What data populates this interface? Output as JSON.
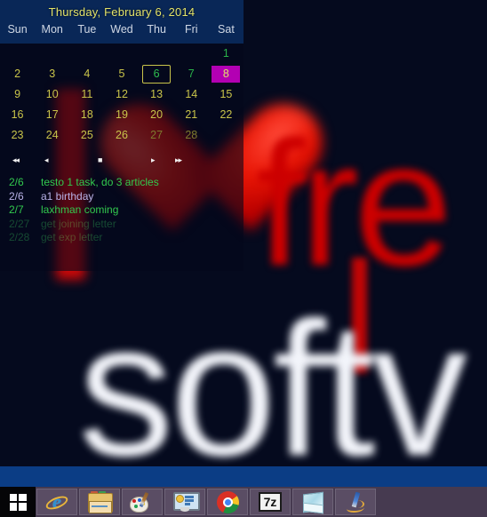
{
  "wallpaper": {
    "watermark_red": "fre",
    "watermark_white": "softv",
    "note": "blurred red heart graphic"
  },
  "calendar": {
    "title": "Thursday, February 6, 2014",
    "day_headers": [
      "Sun",
      "Mon",
      "Tue",
      "Wed",
      "Thu",
      "Fri",
      "Sat"
    ],
    "weeks": [
      [
        {
          "num": "",
          "state": "empty"
        },
        {
          "num": "",
          "state": "empty"
        },
        {
          "num": "",
          "state": "empty"
        },
        {
          "num": "",
          "state": "empty"
        },
        {
          "num": "",
          "state": "empty"
        },
        {
          "num": "",
          "state": "empty"
        },
        {
          "num": "1",
          "state": "green"
        }
      ],
      [
        {
          "num": "2",
          "state": "normal"
        },
        {
          "num": "3",
          "state": "normal"
        },
        {
          "num": "4",
          "state": "normal"
        },
        {
          "num": "5",
          "state": "normal"
        },
        {
          "num": "6",
          "state": "today"
        },
        {
          "num": "7",
          "state": "green"
        },
        {
          "num": "8",
          "state": "selected"
        }
      ],
      [
        {
          "num": "9",
          "state": "normal"
        },
        {
          "num": "10",
          "state": "normal"
        },
        {
          "num": "11",
          "state": "normal"
        },
        {
          "num": "12",
          "state": "normal"
        },
        {
          "num": "13",
          "state": "normal"
        },
        {
          "num": "14",
          "state": "normal"
        },
        {
          "num": "15",
          "state": "normal"
        }
      ],
      [
        {
          "num": "16",
          "state": "normal"
        },
        {
          "num": "17",
          "state": "normal"
        },
        {
          "num": "18",
          "state": "normal"
        },
        {
          "num": "19",
          "state": "normal"
        },
        {
          "num": "20",
          "state": "normal"
        },
        {
          "num": "21",
          "state": "normal"
        },
        {
          "num": "22",
          "state": "normal"
        }
      ],
      [
        {
          "num": "23",
          "state": "normal"
        },
        {
          "num": "24",
          "state": "normal"
        },
        {
          "num": "25",
          "state": "normal"
        },
        {
          "num": "26",
          "state": "normal"
        },
        {
          "num": "27",
          "state": "dim"
        },
        {
          "num": "28",
          "state": "dim"
        },
        {
          "num": "",
          "state": "empty"
        }
      ]
    ],
    "nav": {
      "first_label": "◂◂",
      "prev_label": "◂",
      "stop_label": "■",
      "next_label": "▸",
      "last_label": "▸▸"
    },
    "events": [
      {
        "date": "2/6",
        "text": "testo 1 task, do 3 articles",
        "style": "green"
      },
      {
        "date": "2/6",
        "text": "a1 birthday",
        "style": "blue"
      },
      {
        "date": "2/7",
        "text": "laxhman coming",
        "style": "green"
      },
      {
        "date": "2/27",
        "text": "get joining letter",
        "style": "dim"
      },
      {
        "date": "2/28",
        "text": "get exp letter",
        "style": "dim"
      }
    ]
  },
  "taskbar": {
    "start_label": "Start",
    "items": [
      {
        "name": "internet-explorer",
        "label": "Internet Explorer"
      },
      {
        "name": "file-explorer",
        "label": "File Explorer"
      },
      {
        "name": "paint",
        "label": "Paint"
      },
      {
        "name": "control-panel",
        "label": "Control Panel"
      },
      {
        "name": "google-chrome",
        "label": "Google Chrome"
      },
      {
        "name": "seven-zip",
        "label": "7-Zip",
        "glyph": "7z"
      },
      {
        "name": "notes",
        "label": "Notes"
      },
      {
        "name": "pen-tool",
        "label": "Pen Tool"
      }
    ]
  },
  "colors": {
    "header_blue": "#0a2c61",
    "title_yellow": "#e3e36a",
    "day_number": "#c9c44a",
    "green": "#32c94e",
    "selected_magenta": "#b300b3",
    "taskbar": "#463a50",
    "blue_band": "#0b3d85",
    "wallpaper_bg": "#050a1e",
    "watermark_red": "#cc0000"
  }
}
